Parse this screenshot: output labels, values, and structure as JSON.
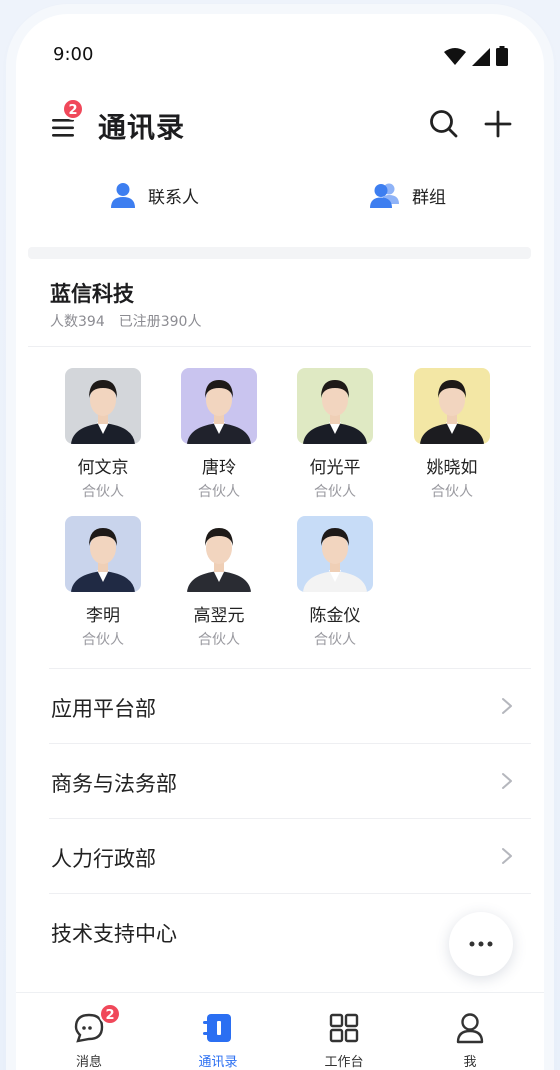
{
  "status_bar": {
    "time": "9:00"
  },
  "header": {
    "title": "通讯录",
    "menu_badge": "2"
  },
  "tabs": [
    {
      "label": "联系人",
      "icon": "person-icon"
    },
    {
      "label": "群组",
      "icon": "group-icon"
    }
  ],
  "organization": {
    "name": "蓝信科技",
    "headcount": "人数394",
    "registered": "已注册390人"
  },
  "members": [
    {
      "name": "何文京",
      "role": "合伙人",
      "bg": "#d3d6da",
      "suit": "#1b1f2a"
    },
    {
      "name": "唐玲",
      "role": "合伙人",
      "bg": "#c9c4ef",
      "suit": "#20222c"
    },
    {
      "name": "何光平",
      "role": "合伙人",
      "bg": "#dfe9c3",
      "suit": "#1a1d26"
    },
    {
      "name": "姚晓如",
      "role": "合伙人",
      "bg": "#f3e7a5",
      "suit": "#1c1c20"
    },
    {
      "name": "李明",
      "role": "合伙人",
      "bg": "#c9d4ec",
      "suit": "#202a44"
    },
    {
      "name": "高翌元",
      "role": "合伙人",
      "bg": "#ffffff",
      "suit": "#2a2c33"
    },
    {
      "name": "陈金仪",
      "role": "合伙人",
      "bg": "#c7dcf7",
      "suit": "#f3f3f3"
    }
  ],
  "departments": [
    {
      "name": "应用平台部",
      "has_chevron": true
    },
    {
      "name": "商务与法务部",
      "has_chevron": true
    },
    {
      "name": "人力行政部",
      "has_chevron": true
    },
    {
      "name": "技术支持中心",
      "has_chevron": false
    }
  ],
  "tabbar": [
    {
      "label": "消息",
      "icon": "chat-icon",
      "badge": "2",
      "active": false
    },
    {
      "label": "通讯录",
      "icon": "contacts-book-icon",
      "active": true
    },
    {
      "label": "工作台",
      "icon": "grid-icon",
      "active": false
    },
    {
      "label": "我",
      "icon": "profile-icon",
      "active": false
    }
  ],
  "colors": {
    "accent": "#2b6ff2",
    "badge": "#f0485a",
    "text": "#222222",
    "muted": "#9a9aa0"
  }
}
